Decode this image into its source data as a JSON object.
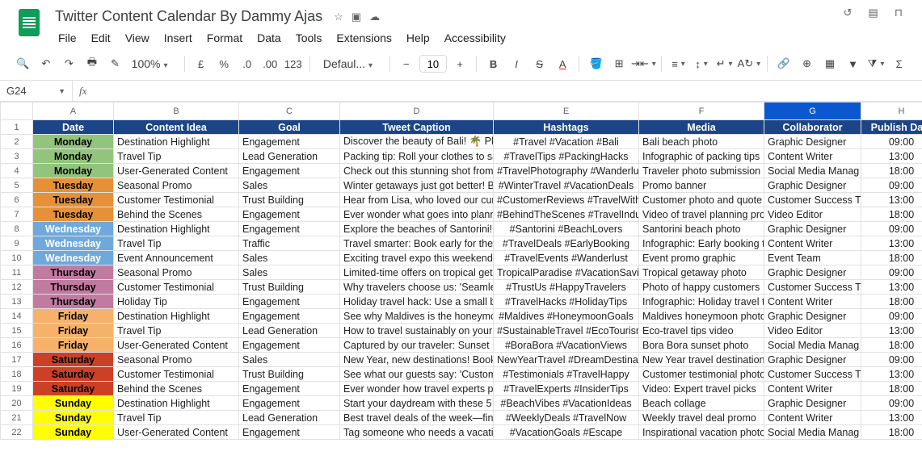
{
  "doc": {
    "title": "Twitter Content Calendar By Dammy Ajas"
  },
  "menus": [
    "File",
    "Edit",
    "View",
    "Insert",
    "Format",
    "Data",
    "Tools",
    "Extensions",
    "Help",
    "Accessibility"
  ],
  "toolbar": {
    "zoom": "100%",
    "font": "Defaul...",
    "fontSize": "10"
  },
  "namebox": "G24",
  "colHeaders": [
    "A",
    "B",
    "C",
    "D",
    "E",
    "F",
    "G",
    "H"
  ],
  "tableHeaders": [
    "Date",
    "Content Idea",
    "Goal",
    "Tweet Caption",
    "Hashtags",
    "Media",
    "Collaborator",
    "Publish Date"
  ],
  "dayColors": {
    "Monday": "#93c47d",
    "Tuesday": "#e69138",
    "Wednesday": "#6fa8dc",
    "Thursday": "#c27ba0",
    "Friday": "#f6b26b",
    "Saturday": "#cc4125",
    "Sunday": "#ffff00"
  },
  "rows": [
    {
      "day": "Monday",
      "idea": "Destination Highlight",
      "goal": "Engagement",
      "caption": "Discover the beauty of Bali! 🌴 Pla",
      "hashtags": "#Travel #Vacation #Bali",
      "media": "Bali beach photo",
      "collab": "Graphic Designer",
      "time": "09:00"
    },
    {
      "day": "Monday",
      "idea": "Travel Tip",
      "goal": "Lead Generation",
      "caption": "Packing tip: Roll your clothes to sa",
      "hashtags": "#TravelTips #PackingHacks",
      "media": "Infographic of packing tips",
      "collab": "Content Writer",
      "time": "13:00"
    },
    {
      "day": "Monday",
      "idea": "User-Generated Content",
      "goal": "Engagement",
      "caption": "Check out this stunning shot from o",
      "hashtags": "#TravelPhotography #Wanderlust",
      "media": "Traveler photo submission",
      "collab": "Social Media Manag",
      "time": "18:00"
    },
    {
      "day": "Tuesday",
      "idea": "Seasonal Promo",
      "goal": "Sales",
      "caption": "Winter getaways just got better! Bo",
      "hashtags": "#WinterTravel #VacationDeals",
      "media": "Promo banner",
      "collab": "Graphic Designer",
      "time": "09:00"
    },
    {
      "day": "Tuesday",
      "idea": "Customer Testimonial",
      "goal": "Trust Building",
      "caption": "Hear from Lisa, who loved our cura",
      "hashtags": "#CustomerReviews #TravelWithUs",
      "media": "Customer photo and quote",
      "collab": "Customer Success T",
      "time": "13:00"
    },
    {
      "day": "Tuesday",
      "idea": "Behind the Scenes",
      "goal": "Engagement",
      "caption": "Ever wonder what goes into plannin",
      "hashtags": "#BehindTheScenes #TravelIndustr",
      "media": "Video of travel planning proc",
      "collab": "Video Editor",
      "time": "18:00"
    },
    {
      "day": "Wednesday",
      "idea": "Destination Highlight",
      "goal": "Engagement",
      "caption": "Explore the beaches of Santorini! I",
      "hashtags": "#Santorini #BeachLovers",
      "media": "Santorini beach photo",
      "collab": "Graphic Designer",
      "time": "09:00"
    },
    {
      "day": "Wednesday",
      "idea": "Travel Tip",
      "goal": "Traffic",
      "caption": "Travel smarter: Book early for the b",
      "hashtags": "#TravelDeals #EarlyBooking",
      "media": "Infographic: Early booking tip",
      "collab": "Content Writer",
      "time": "13:00"
    },
    {
      "day": "Wednesday",
      "idea": "Event Announcement",
      "goal": "Sales",
      "caption": "Exciting travel expo this weekend—",
      "hashtags": "#TravelEvents #Wanderlust",
      "media": "Event promo graphic",
      "collab": "Event Team",
      "time": "18:00"
    },
    {
      "day": "Thursday",
      "idea": "Seasonal Promo",
      "goal": "Sales",
      "caption": "Limited-time offers on tropical geta",
      "hashtags": "TropicalParadise #VacationSaving",
      "media": "Tropical getaway photo",
      "collab": "Graphic Designer",
      "time": "09:00"
    },
    {
      "day": "Thursday",
      "idea": "Customer Testimonial",
      "goal": "Trust Building",
      "caption": "Why travelers choose us: 'Seamles",
      "hashtags": "#TrustUs #HappyTravelers",
      "media": "Photo of happy customers",
      "collab": "Customer Success T",
      "time": "13:00"
    },
    {
      "day": "Thursday",
      "idea": "Holiday Tip",
      "goal": "Engagement",
      "caption": "Holiday travel hack: Use a small ba",
      "hashtags": "#TravelHacks #HolidayTips",
      "media": "Infographic: Holiday travel tip",
      "collab": "Content Writer",
      "time": "18:00"
    },
    {
      "day": "Friday",
      "idea": "Destination Highlight",
      "goal": "Engagement",
      "caption": "See why Maldives is the honeymoo",
      "hashtags": "#Maldives #HoneymoonGoals",
      "media": "Maldives honeymoon photo",
      "collab": "Graphic Designer",
      "time": "09:00"
    },
    {
      "day": "Friday",
      "idea": "Travel Tip",
      "goal": "Lead Generation",
      "caption": "How to travel sustainably on your n",
      "hashtags": "#SustainableTravel #EcoTourism",
      "media": "Eco-travel tips video",
      "collab": "Video Editor",
      "time": "13:00"
    },
    {
      "day": "Friday",
      "idea": "User-Generated Content",
      "goal": "Engagement",
      "caption": "Captured by our traveler: Sunset in",
      "hashtags": "#BoraBora #VacationViews",
      "media": "Bora Bora sunset photo",
      "collab": "Social Media Manag",
      "time": "18:00"
    },
    {
      "day": "Saturday",
      "idea": "Seasonal Promo",
      "goal": "Sales",
      "caption": "New Year, new destinations! Book n",
      "hashtags": "NewYearTravel #DreamDestination",
      "media": "New Year travel destinations",
      "collab": "Graphic Designer",
      "time": "09:00"
    },
    {
      "day": "Saturday",
      "idea": "Customer Testimonial",
      "goal": "Trust Building",
      "caption": "See what our guests say: 'Custome",
      "hashtags": "#Testimonials #TravelHappy",
      "media": "Customer testimonial photo",
      "collab": "Customer Success T",
      "time": "13:00"
    },
    {
      "day": "Saturday",
      "idea": "Behind the Scenes",
      "goal": "Engagement",
      "caption": "Ever wonder how travel experts pic",
      "hashtags": "#TravelExperts #InsiderTips",
      "media": "Video: Expert travel picks",
      "collab": "Content Writer",
      "time": "18:00"
    },
    {
      "day": "Sunday",
      "idea": "Destination Highlight",
      "goal": "Engagement",
      "caption": "Start your daydream with these 5 m",
      "hashtags": "#BeachVibes #VacationIdeas",
      "media": "Beach collage",
      "collab": "Graphic Designer",
      "time": "09:00"
    },
    {
      "day": "Sunday",
      "idea": "Travel Tip",
      "goal": "Lead Generation",
      "caption": "Best travel deals of the week—find",
      "hashtags": "#WeeklyDeals #TravelNow",
      "media": "Weekly travel deal promo",
      "collab": "Content Writer",
      "time": "13:00"
    },
    {
      "day": "Sunday",
      "idea": "User-Generated Content",
      "goal": "Engagement",
      "caption": "Tag someone who needs a vacatio",
      "hashtags": "#VacationGoals #Escape",
      "media": "Inspirational vacation photo",
      "collab": "Social Media Manag",
      "time": "18:00"
    }
  ]
}
